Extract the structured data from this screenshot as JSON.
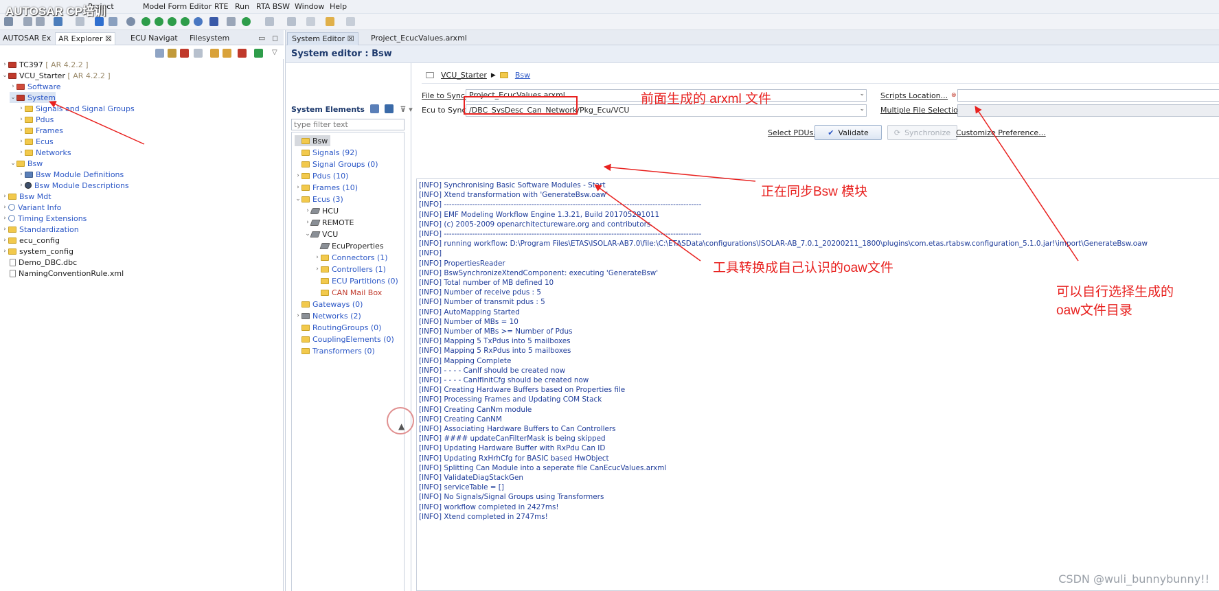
{
  "watermark_title": "AUTOSAR CP培训",
  "menu": [
    "Project",
    "Model Form Editor",
    "RTE",
    "Run",
    "RTA BSW",
    "Window",
    "Help"
  ],
  "left_tabs": [
    "AUTOSAR Ex",
    "AR Explorer",
    "ECU Navigat",
    "Filesystem"
  ],
  "left_tree": [
    {
      "label": "TC397",
      "version": "[ AR 4.2.2 ]"
    },
    {
      "label": "VCU_Starter",
      "version": "[ AR 4.2.2 ]"
    },
    {
      "label": "Software"
    },
    {
      "label": "System"
    },
    {
      "label": "Signals and Signal Groups"
    },
    {
      "label": "Pdus"
    },
    {
      "label": "Frames"
    },
    {
      "label": "Ecus"
    },
    {
      "label": "Networks"
    },
    {
      "label": "Bsw"
    },
    {
      "label": "Bsw Module Definitions"
    },
    {
      "label": "Bsw Module Descriptions"
    },
    {
      "label": "Bsw Mdt"
    },
    {
      "label": "Variant Info"
    },
    {
      "label": "Timing Extensions"
    },
    {
      "label": "Standardization"
    },
    {
      "label": "ecu_config"
    },
    {
      "label": "system_config"
    },
    {
      "label": "Demo_DBC.dbc"
    },
    {
      "label": "NamingConventionRule.xml"
    }
  ],
  "right_tabs": [
    "System Editor",
    "Project_EcucValues.arxml"
  ],
  "editor_title": "System editor : Bsw",
  "system_elements": {
    "header": "System Elements",
    "filter_placeholder": "type filter text",
    "items": [
      "Bsw",
      "Signals (92)",
      "Signal Groups (0)",
      "Pdus (10)",
      "Frames (10)",
      "Ecus (3)",
      "HCU",
      "REMOTE",
      "VCU",
      "EcuProperties",
      "Connectors (1)",
      "Controllers (1)",
      "ECU Partitions (0)",
      "CAN Mail Box",
      "Gateways (0)",
      "Networks (2)",
      "RoutingGroups (0)",
      "CouplingElements (0)",
      "Transformers (0)"
    ]
  },
  "breadcrumb": [
    "VCU_Starter",
    "Bsw"
  ],
  "form": {
    "file_to_sync_label": "File to Sync...",
    "file_to_sync_value": "Project_EcucValues.arxml",
    "ecu_to_sync_label": "Ecu to Sync",
    "ecu_to_sync_value": "/DBC_SysDesc_Can_Network/Pkg_Ecu/VCU",
    "scripts_location": "Scripts Location...",
    "multiple_file_selection": "Multiple File Selection...",
    "select_pdus": "Select PDUs...",
    "validate": "Validate",
    "synchronize": "Synchronize",
    "customize_preference": "Customize Preference..."
  },
  "log": [
    "[INFO] Synchronising Basic Software Modules - Start",
    "[INFO] Xtend transformation with 'GenerateBsw.oaw'",
    "[INFO] ----------------------------------------------------------------------------------------------------",
    "[INFO] EMF Modeling Workflow Engine 1.3.21, Build 201705291011",
    "[INFO] (c) 2005-2009 openarchitectureware.org and contributors",
    "[INFO] ----------------------------------------------------------------------------------------------------",
    "[INFO] running workflow: D:\\Program Files\\ETAS\\ISOLAR-AB7.0\\file:\\C:\\ETASData\\configurations\\ISOLAR-AB_7.0.1_20200211_1800\\plugins\\com.etas.rtabsw.configuration_5.1.0.jar!\\import\\GenerateBsw.oaw",
    "[INFO]",
    "[INFO] PropertiesReader",
    "[INFO] BswSynchronizeXtendComponent: executing 'GenerateBsw'",
    "[INFO] Total number of MB defined 10",
    "[INFO] Number of receive pdus : 5",
    "[INFO] Number of transmit pdus : 5",
    "[INFO] AutoMapping Started",
    "[INFO] Number of MBs = 10",
    "[INFO] Number of MBs >= Number of Pdus",
    "[INFO] Mapping 5 TxPdus into 5 mailboxes",
    "[INFO] Mapping 5 RxPdus into 5 mailboxes",
    "[INFO] Mapping Complete",
    "[INFO] - - - - CanIf should be created now",
    "[INFO] - - - - CanIfInitCfg should be created now",
    "[INFO] Creating Hardware Buffers based on Properties file",
    "[INFO] Processing Frames and Updating COM Stack",
    "[INFO] Creating CanNm module",
    "[INFO] Creating CanNM",
    "[INFO] Associating Hardware Buffers to Can Controllers",
    "[INFO] #### updateCanFilterMask is being skipped",
    "[INFO] Updating Hardware Buffer with RxPdu Can ID",
    "[INFO] Updating RxHrhCfg for BASIC based HwObject",
    "[INFO] Splitting Can Module into a seperate file CanEcucValues.arxml",
    "[INFO] ValidateDiagStackGen",
    "[INFO] serviceTable = []",
    "[INFO] No Signals/Signal Groups using Transformers",
    "[INFO] workflow completed in 2427ms!",
    "[INFO] Xtend completed in 2747ms!"
  ],
  "annotations": {
    "arxml_file": "前面生成的 arxml 文件",
    "sync_bsw": "正在同步Bsw 模块",
    "oaw_convert": "工具转换成自己认识的oaw文件",
    "oaw_dir_line1": "可以自行选择生成的",
    "oaw_dir_line2": "oaw文件目录"
  },
  "csdn_watermark": "CSDN @wuli_bunnybunny!!",
  "colors": {
    "annotation_red": "#e8211f",
    "link_blue": "#2a56c6",
    "log_blue": "#1d3b99"
  }
}
